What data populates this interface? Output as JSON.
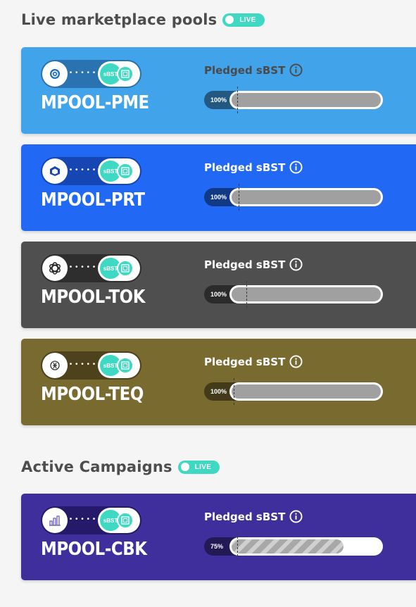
{
  "sections": {
    "marketplace": {
      "title": "Live marketplace pools",
      "badge": "LIVE"
    },
    "campaigns": {
      "title": "Active Campaigns",
      "badge": "LIVE"
    }
  },
  "pools": [
    {
      "name": "MPOOL-PME",
      "label": "Pledged sBST",
      "progress_text": "100%",
      "progress": 1.0,
      "icon": "pme-token-icon",
      "bg": "#41a3ea",
      "pair_bg": "#2a72b0"
    },
    {
      "name": "MPOOL-PRT",
      "label": "Pledged sBST",
      "progress_text": "100%",
      "progress": 1.0,
      "icon": "prt-token-icon",
      "bg": "#2169f5",
      "pair_bg": "#1546b4"
    },
    {
      "name": "MPOOL-TOK",
      "label": "Pledged sBST",
      "progress_text": "100%",
      "progress": 1.0,
      "icon": "tok-token-icon",
      "bg": "#4f4f4f",
      "pair_bg": "#2e2e2e"
    },
    {
      "name": "MPOOL-TEQ",
      "label": "Pledged sBST",
      "progress_text": "100%",
      "progress": 1.0,
      "icon": "teq-token-icon",
      "bg": "#796a30",
      "pair_bg": "#4d421c"
    }
  ],
  "campaigns": [
    {
      "name": "MPOOL-CBK",
      "label": "Pledged sBST",
      "progress_text": "75%",
      "progress": 0.75,
      "icon": "cbk-token-icon",
      "bg": "#3e2f9c",
      "pair_bg": "#251a6a"
    }
  ],
  "token_b_label": "sBST",
  "colors": {
    "accent": "#3fd8c2",
    "title": "#4d4d4d"
  }
}
